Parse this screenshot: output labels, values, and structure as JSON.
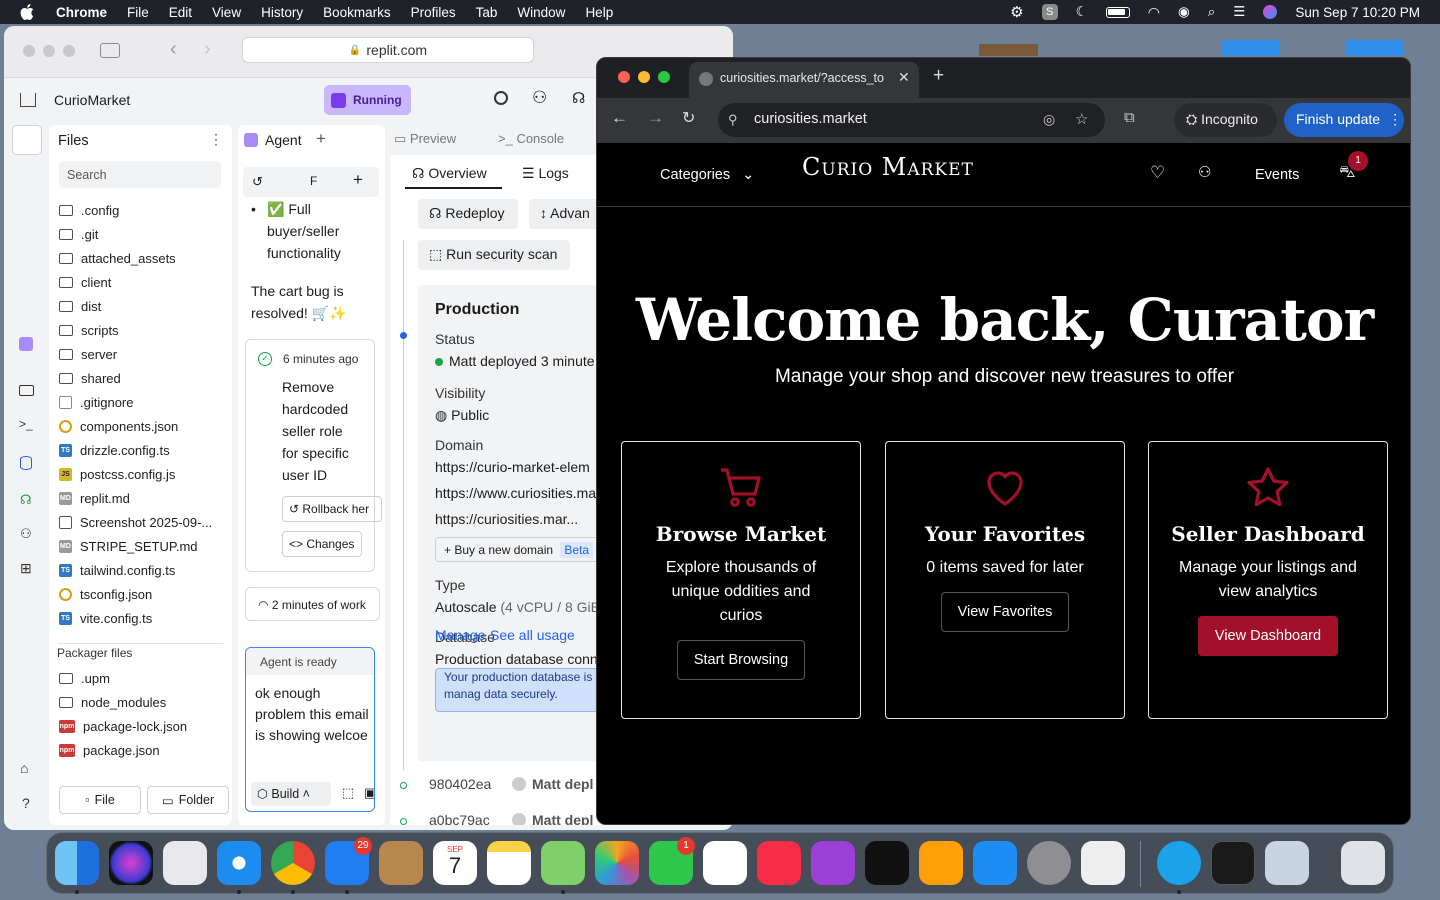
{
  "menubar": {
    "app": "Chrome",
    "items": [
      "File",
      "Edit",
      "View",
      "History",
      "Bookmarks",
      "Profiles",
      "Tab",
      "Window",
      "Help"
    ],
    "datetime": "Sun Sep 7  10:20 PM"
  },
  "replit": {
    "url": "replit.com",
    "project": "CurioMarket",
    "status": "Running",
    "files": {
      "title": "Files",
      "search_placeholder": "Search",
      "items": [
        {
          "name": ".config",
          "kind": "folder"
        },
        {
          "name": ".git",
          "kind": "folder"
        },
        {
          "name": "attached_assets",
          "kind": "folder"
        },
        {
          "name": "client",
          "kind": "folder"
        },
        {
          "name": "dist",
          "kind": "folder"
        },
        {
          "name": "scripts",
          "kind": "folder"
        },
        {
          "name": "server",
          "kind": "folder"
        },
        {
          "name": "shared",
          "kind": "folder"
        },
        {
          "name": ".gitignore",
          "kind": "file"
        },
        {
          "name": "components.json",
          "kind": "json"
        },
        {
          "name": "drizzle.config.ts",
          "kind": "ts"
        },
        {
          "name": "postcss.config.js",
          "kind": "js"
        },
        {
          "name": "replit.md",
          "kind": "md"
        },
        {
          "name": "Screenshot 2025-09-...",
          "kind": "img"
        },
        {
          "name": "STRIPE_SETUP.md",
          "kind": "md"
        },
        {
          "name": "tailwind.config.ts",
          "kind": "ts"
        },
        {
          "name": "tsconfig.json",
          "kind": "json"
        },
        {
          "name": "vite.config.ts",
          "kind": "ts"
        }
      ],
      "packager_title": "Packager files",
      "packager": [
        {
          "name": ".upm",
          "kind": "folder"
        },
        {
          "name": "node_modules",
          "kind": "folder"
        },
        {
          "name": "package-lock.json",
          "kind": "npm"
        },
        {
          "name": "package.json",
          "kind": "npm"
        }
      ],
      "new_file": "File",
      "new_folder": "Folder"
    },
    "agent": {
      "tab": "Agent",
      "search_letter": "F",
      "check_item": "✅ Full buyer/seller functionality",
      "resolved": "The cart bug is resolved! 🛒✨",
      "checkpoint_time": "6 minutes ago",
      "checkpoint_text": "Remove hardcoded seller role for specific user ID",
      "rollback": "Rollback her",
      "changes": "Changes",
      "work_time": "2 minutes of work",
      "ready": "Agent is ready",
      "input": "ok enough problem this email is showing welcoe",
      "build": "Build"
    },
    "deploy": {
      "tab_preview": "Preview",
      "tab_console": "Console",
      "tab_overview": "Overview",
      "tab_logs": "Logs",
      "redeploy": "Redeploy",
      "advanced": "Advan",
      "scan": "Run security scan",
      "production": "Production",
      "status_label": "Status",
      "status_value": "Matt deployed 3 minute",
      "visibility_label": "Visibility",
      "visibility_value": "Public",
      "domain_label": "Domain",
      "domains": [
        "https://curio-market-elem",
        "https://www.curiosities.ma",
        "https://curiosities.mar..."
      ],
      "buy_domain": "Buy a new domain",
      "beta": "Beta",
      "type_label": "Type",
      "type_value": "Autoscale",
      "type_spec": "(4 vCPU / 8 GiB",
      "manage": "Manage",
      "see_usage": "See all usage",
      "database_label": "Database",
      "db_conn": "Production database conn",
      "db_note": "Your production database is r app can now save and manag data securely.",
      "commits": [
        {
          "hash": "980402ea",
          "who": "Matt depl"
        },
        {
          "hash": "a0bc79ac",
          "who": "Matt depl"
        }
      ]
    }
  },
  "browser": {
    "tab_title": "curiosities.market/?access_to",
    "url": "curiosities.market",
    "incognito": "Incognito",
    "finish_update": "Finish update",
    "site": {
      "categories": "Categories",
      "logo": "Curio Market",
      "events": "Events",
      "cart_badge": "1",
      "hero_title": "Welcome back, Curator",
      "hero_sub": "Manage your shop and discover new treasures to offer",
      "cards": [
        {
          "title": "Browse Market",
          "text": "Explore thousands of unique oddities and curios",
          "button": "Start Browsing",
          "icon": "cart-icon"
        },
        {
          "title": "Your Favorites",
          "text": "0 items saved for later",
          "button": "View Favorites",
          "icon": "heart-icon"
        },
        {
          "title": "Seller Dashboard",
          "text": "Manage your listings and view analytics",
          "button": "View Dashboard",
          "icon": "star-icon"
        }
      ]
    }
  },
  "dock": {
    "mail_badge": "29",
    "facetime_badge": "1",
    "calendar_month": "SEP",
    "calendar_day": "7"
  },
  "colors": {
    "accent_red": "#a3102a",
    "replit_purple": "#a78bfa",
    "chrome_blue": "#1f63c8"
  }
}
